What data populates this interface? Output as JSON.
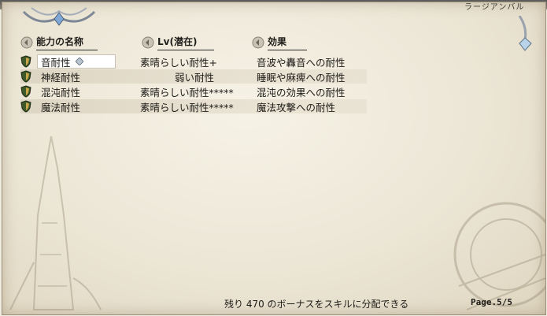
{
  "top_right_text": "ラージアンバル",
  "columns": {
    "name": "能力の名称",
    "level": "Lv(潜在)",
    "effect": "効果"
  },
  "skills": [
    {
      "name": "音耐性",
      "level": "素晴らしい耐性+",
      "effect": "音波や轟音への耐性",
      "selected": true
    },
    {
      "name": "神経耐性",
      "level": "弱い耐性",
      "effect": "睡眠や麻痺への耐性",
      "selected": false
    },
    {
      "name": "混沌耐性",
      "level": "素晴らしい耐性*****",
      "effect": "混沌の効果への耐性",
      "selected": false
    },
    {
      "name": "魔法耐性",
      "level": "素晴らしい耐性*****",
      "effect": "魔法攻撃への耐性",
      "selected": false
    }
  ],
  "footer": {
    "bonus_text": "残り 470 のボーナスをスキルに分配できる",
    "page": "Page.5/5"
  },
  "colors": {
    "parchment": "#f1ece0",
    "text": "#1d1b17",
    "shield_green": "#3f5a2a"
  },
  "icons": {
    "header_icon": "round-header-icon",
    "row_icon": "shield-icon",
    "selection": "diamond-cursor-icon"
  }
}
